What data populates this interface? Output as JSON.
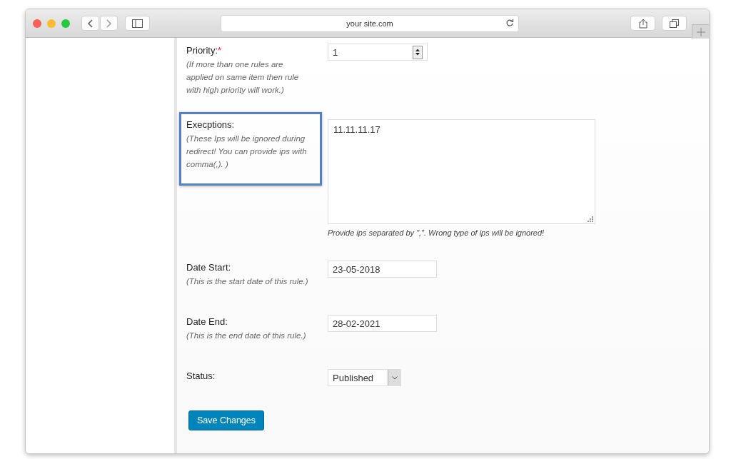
{
  "browser": {
    "address": "your site.com"
  },
  "fields": [
    {
      "kind": "number",
      "label": "Priority:",
      "required_mark": "*",
      "hint": "(If more than one rules are applied on same item then rule with high priority will work.)",
      "value": "1"
    },
    {
      "kind": "textarea",
      "label": "Execptions:",
      "highlighted": true,
      "hint": "(These Ips will be ignored during redirect! You can provide ips with comma(,). )",
      "value": "11.11.11.17",
      "help": "Provide ips separated by \",\". Wrong type of ips will be ignored!"
    },
    {
      "kind": "text",
      "label": "Date Start:",
      "hint": "(This is the start date of this rule.)",
      "value": "23-05-2018"
    },
    {
      "kind": "text",
      "label": "Date End:",
      "hint": "(This is the end date of this rule.)",
      "value": "28-02-2021"
    },
    {
      "kind": "select",
      "label": "Status:",
      "value": "Published"
    }
  ],
  "save_button": "Save Changes"
}
